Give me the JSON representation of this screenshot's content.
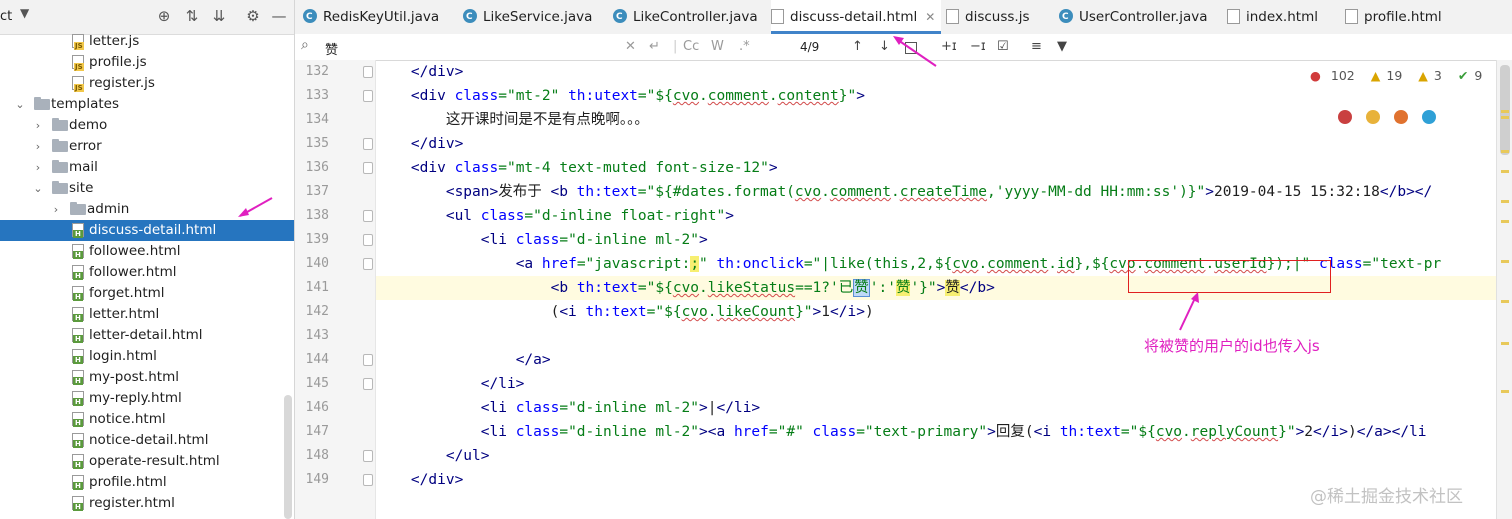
{
  "sidebar": {
    "project_label": "ct",
    "items": [
      {
        "label": "letter.js",
        "type": "js"
      },
      {
        "label": "profile.js",
        "type": "js"
      },
      {
        "label": "register.js",
        "type": "js"
      },
      {
        "label": "templates",
        "type": "folder",
        "expanded": true
      },
      {
        "label": "demo",
        "type": "folder",
        "expanded": false
      },
      {
        "label": "error",
        "type": "folder",
        "expanded": false
      },
      {
        "label": "mail",
        "type": "folder",
        "expanded": false
      },
      {
        "label": "site",
        "type": "folder",
        "expanded": true
      },
      {
        "label": "admin",
        "type": "folder",
        "expanded": false
      },
      {
        "label": "discuss-detail.html",
        "type": "html",
        "selected": true
      },
      {
        "label": "followee.html",
        "type": "html"
      },
      {
        "label": "follower.html",
        "type": "html"
      },
      {
        "label": "forget.html",
        "type": "html"
      },
      {
        "label": "letter.html",
        "type": "html"
      },
      {
        "label": "letter-detail.html",
        "type": "html"
      },
      {
        "label": "login.html",
        "type": "html"
      },
      {
        "label": "my-post.html",
        "type": "html"
      },
      {
        "label": "my-reply.html",
        "type": "html"
      },
      {
        "label": "notice.html",
        "type": "html"
      },
      {
        "label": "notice-detail.html",
        "type": "html"
      },
      {
        "label": "operate-result.html",
        "type": "html"
      },
      {
        "label": "profile.html",
        "type": "html"
      },
      {
        "label": "register.html",
        "type": "html"
      }
    ]
  },
  "tabs": [
    {
      "label": "RedisKeyUtil.java",
      "type": "java"
    },
    {
      "label": "LikeService.java",
      "type": "java"
    },
    {
      "label": "LikeController.java",
      "type": "java"
    },
    {
      "label": "discuss-detail.html",
      "type": "html",
      "active": true
    },
    {
      "label": "discuss.js",
      "type": "js"
    },
    {
      "label": "UserController.java",
      "type": "java"
    },
    {
      "label": "index.html",
      "type": "html"
    },
    {
      "label": "profile.html",
      "type": "html"
    }
  ],
  "search": {
    "query": "赞",
    "match_count": "4/9",
    "case_label": "Cc",
    "word_label": "W",
    "regex_label": ".*"
  },
  "inspection": {
    "errors": "102",
    "warnings": "19",
    "weak_warnings": "3",
    "typos": "9"
  },
  "code_lines": [
    {
      "n": "132"
    },
    {
      "n": "133"
    },
    {
      "n": "134"
    },
    {
      "n": "135"
    },
    {
      "n": "136"
    },
    {
      "n": "137"
    },
    {
      "n": "138"
    },
    {
      "n": "139"
    },
    {
      "n": "140"
    },
    {
      "n": "141"
    },
    {
      "n": "142"
    },
    {
      "n": "143"
    },
    {
      "n": "144"
    },
    {
      "n": "145"
    },
    {
      "n": "146"
    },
    {
      "n": "147"
    },
    {
      "n": "148"
    },
    {
      "n": "149"
    }
  ],
  "code_text": {
    "l134_text": "这开课时间是不是有点晚啊。。。",
    "l137_text": "发布于 ",
    "l137_date": "2019-04-15 15:32:18",
    "l147_text": "回复(",
    "l141_yi": "已",
    "l141_zan": "赞",
    "l141_zan2": "赞",
    "l141_zan3": "赞"
  },
  "annotation": "将被赞的用户的id也传入js",
  "watermark": "@稀土掘金技术社区",
  "colors": {
    "tag": "#000080",
    "attr": "#0000ff",
    "string": "#067d17",
    "selection": "#2675bf",
    "annotation": "#e020c0",
    "redbox": "#e02020"
  }
}
